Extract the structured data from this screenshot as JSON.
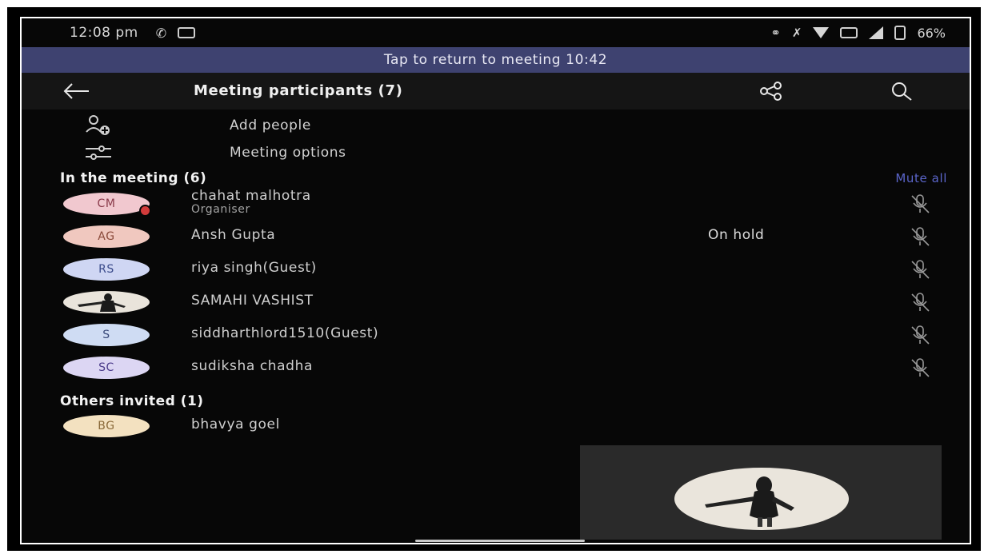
{
  "status_bar": {
    "time": "12:08 pm",
    "battery": "66%"
  },
  "return_banner": "Tap to return to meeting 10:42",
  "app_bar": {
    "title": "Meeting participants (7)"
  },
  "actions": {
    "add_people": "Add people",
    "meeting_options": "Meeting options"
  },
  "in_meeting": {
    "heading": "In the meeting (6)",
    "mute_all": "Mute all",
    "participants": [
      {
        "initials": "CM",
        "name": "chahat malhotra",
        "role": "Organiser",
        "status": "",
        "avatar_bg": "#f1c8cf",
        "avatar_fg": "#8a3a4a"
      },
      {
        "initials": "AG",
        "name": "Ansh Gupta",
        "role": "",
        "status": "On hold",
        "avatar_bg": "#f0c8bf",
        "avatar_fg": "#8a4a3a"
      },
      {
        "initials": "RS",
        "name": "riya singh(Guest)",
        "role": "",
        "status": "",
        "avatar_bg": "#cfd6f3",
        "avatar_fg": "#3a4a8a"
      },
      {
        "initials": "",
        "name": "SAMAHI VASHIST",
        "role": "",
        "status": "",
        "avatar_bg": "#e9e4db",
        "avatar_fg": "#222222"
      },
      {
        "initials": "S",
        "name": "siddharthlord1510(Guest)",
        "role": "",
        "status": "",
        "avatar_bg": "#cfdcf3",
        "avatar_fg": "#3a4a7a"
      },
      {
        "initials": "SC",
        "name": "sudiksha chadha",
        "role": "",
        "status": "",
        "avatar_bg": "#dcd6f3",
        "avatar_fg": "#4a3a8a"
      }
    ]
  },
  "others_invited": {
    "heading": "Others invited (1)",
    "participants": [
      {
        "initials": "BG",
        "name": "bhavya goel",
        "avatar_bg": "#f3e1c0",
        "avatar_fg": "#8a6a3a"
      }
    ]
  }
}
